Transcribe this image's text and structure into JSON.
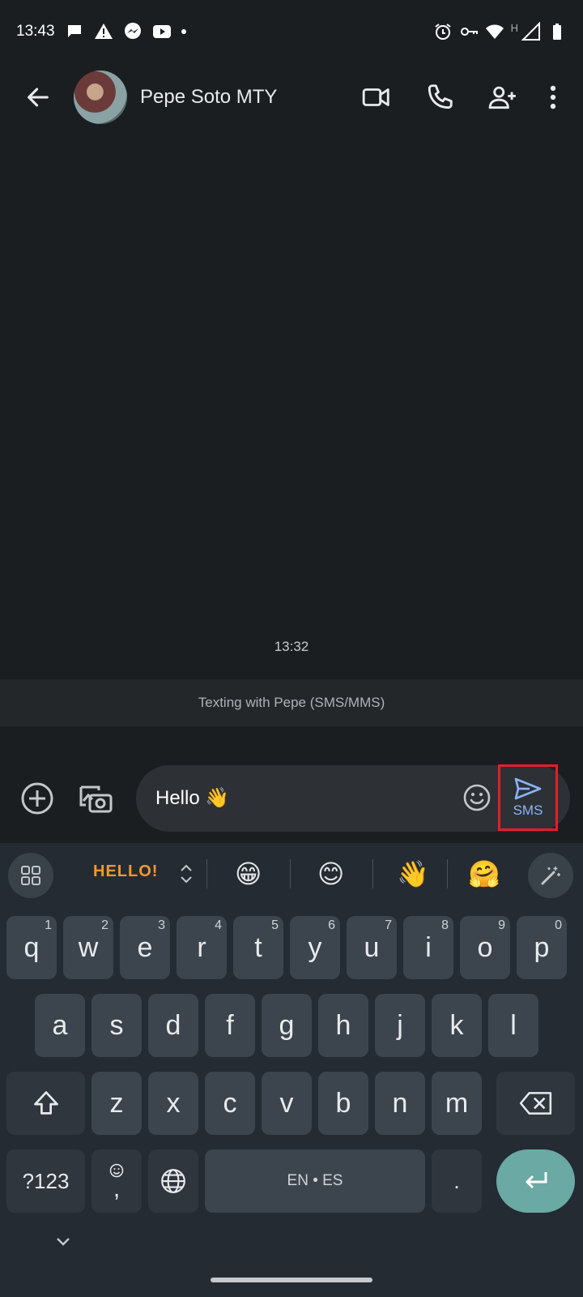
{
  "status_bar": {
    "time": "13:43",
    "left_icons": [
      "chat-bubble-icon",
      "warning-icon",
      "messenger-icon",
      "youtube-icon",
      "dot-icon"
    ],
    "right_icons": [
      "alarm-icon",
      "vpn-key-icon",
      "wifi-icon",
      "signal-icon",
      "battery-icon"
    ],
    "network_label": "H"
  },
  "app_bar": {
    "contact_name": "Pepe Soto MTY",
    "actions": [
      "video-call-icon",
      "phone-icon",
      "add-person-icon",
      "more-vert-icon"
    ]
  },
  "conversation": {
    "timestamp": "13:32",
    "banner": "Texting with Pepe (SMS/MMS)"
  },
  "compose": {
    "message_text": "Hello 👋",
    "send_label": "SMS"
  },
  "keyboard": {
    "toolbar": {
      "sticker_text": "HELLO!",
      "emojis": [
        "😁",
        "😊",
        "👋",
        "🤗"
      ]
    },
    "row1": [
      {
        "k": "q",
        "h": "1"
      },
      {
        "k": "w",
        "h": "2"
      },
      {
        "k": "e",
        "h": "3"
      },
      {
        "k": "r",
        "h": "4"
      },
      {
        "k": "t",
        "h": "5"
      },
      {
        "k": "y",
        "h": "6"
      },
      {
        "k": "u",
        "h": "7"
      },
      {
        "k": "i",
        "h": "8"
      },
      {
        "k": "o",
        "h": "9"
      },
      {
        "k": "p",
        "h": "0"
      }
    ],
    "row2": [
      "a",
      "s",
      "d",
      "f",
      "g",
      "h",
      "j",
      "k",
      "l"
    ],
    "row3": [
      "z",
      "x",
      "c",
      "v",
      "b",
      "n",
      "m"
    ],
    "symbols_label": "?123",
    "comma_label": ",",
    "space_label": "EN • ES",
    "period_label": "."
  },
  "colors": {
    "background": "#1b1e21",
    "keyboard": "#242b32",
    "key": "#3c454d",
    "accent_send": "#8ab4f8",
    "enter_key": "#6aa9a4",
    "highlight_box": "#e0202a"
  }
}
